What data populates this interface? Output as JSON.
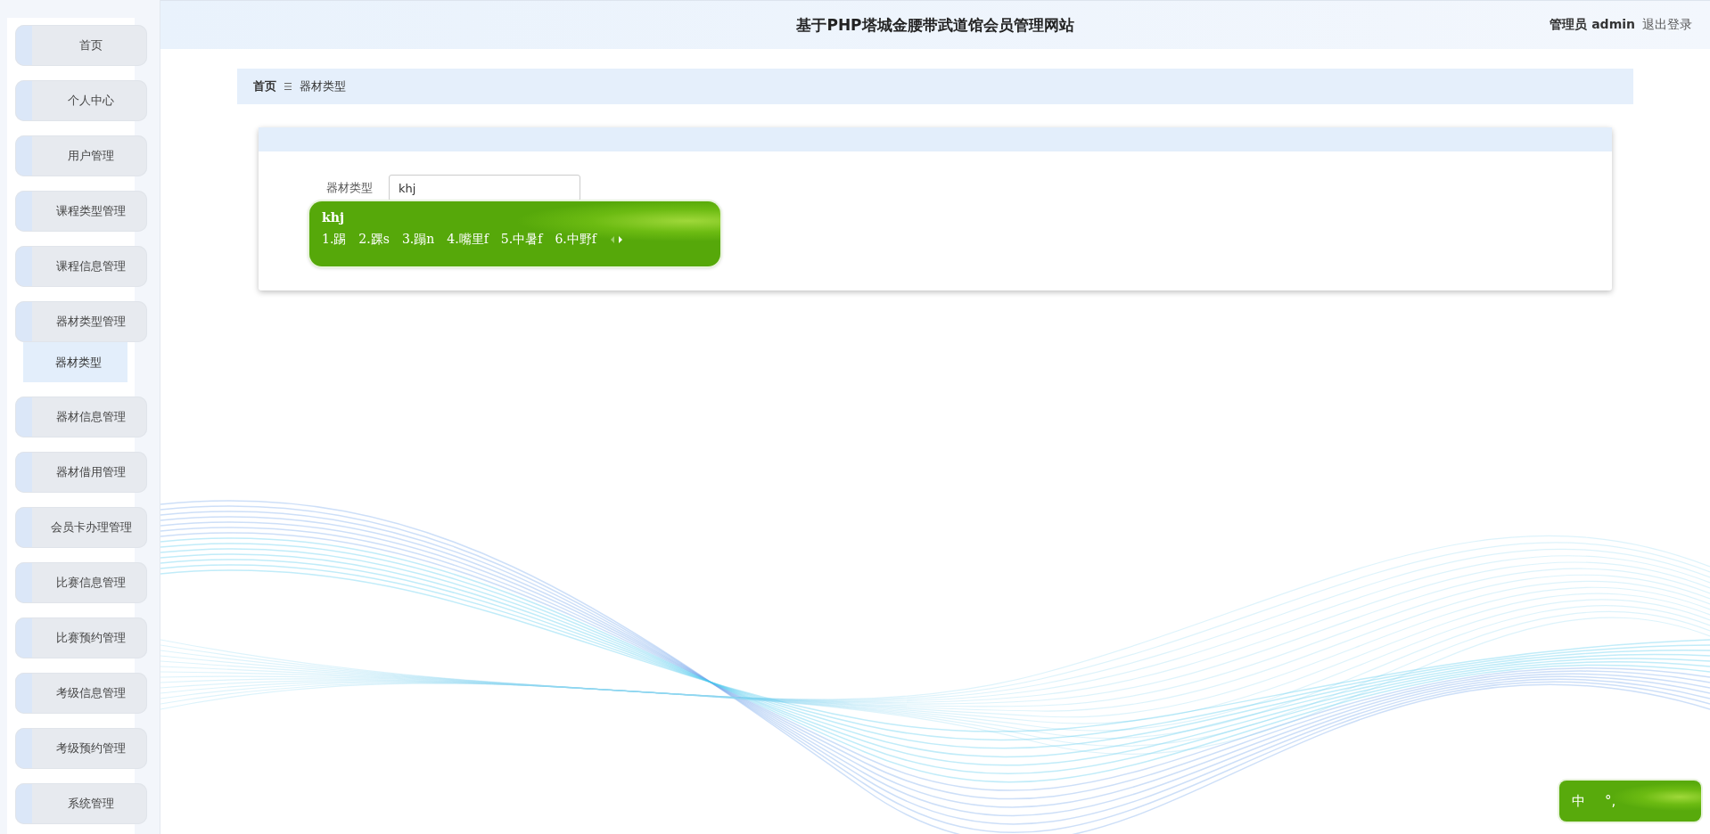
{
  "header": {
    "title": "基于PHP塔城金腰带武道馆会员管理网站",
    "user_role": "管理员",
    "username": "admin",
    "logout": "退出登录"
  },
  "sidebar": {
    "items": [
      {
        "label": "首页",
        "selected": false
      },
      {
        "label": "个人中心",
        "selected": false
      },
      {
        "label": "用户管理",
        "selected": false
      },
      {
        "label": "课程类型管理",
        "selected": false
      },
      {
        "label": "课程信息管理",
        "selected": false
      },
      {
        "label": "器材类型管理",
        "selected": false,
        "children": [
          {
            "label": "器材类型",
            "selected": true
          }
        ]
      },
      {
        "label": "器材信息管理",
        "selected": false
      },
      {
        "label": "器材借用管理",
        "selected": false
      },
      {
        "label": "会员卡办理管理",
        "selected": false
      },
      {
        "label": "比赛信息管理",
        "selected": false
      },
      {
        "label": "比赛预约管理",
        "selected": false
      },
      {
        "label": "考级信息管理",
        "selected": false
      },
      {
        "label": "考级预约管理",
        "selected": false
      },
      {
        "label": "系统管理",
        "selected": false
      }
    ]
  },
  "breadcrumb": [
    {
      "label": "首页"
    },
    {
      "label": "器材类型"
    }
  ],
  "form": {
    "fields": [
      {
        "label": "器材类型",
        "value": "khj"
      }
    ]
  },
  "ime_popup": {
    "composition": "khj",
    "candidates": [
      "1.踢",
      "2.踝s",
      "3.蹋n",
      "4.嘴里f",
      "5.中暑f",
      "6.中野f"
    ]
  },
  "ime_status": {
    "mode": "中",
    "punctuation": "°,"
  }
}
